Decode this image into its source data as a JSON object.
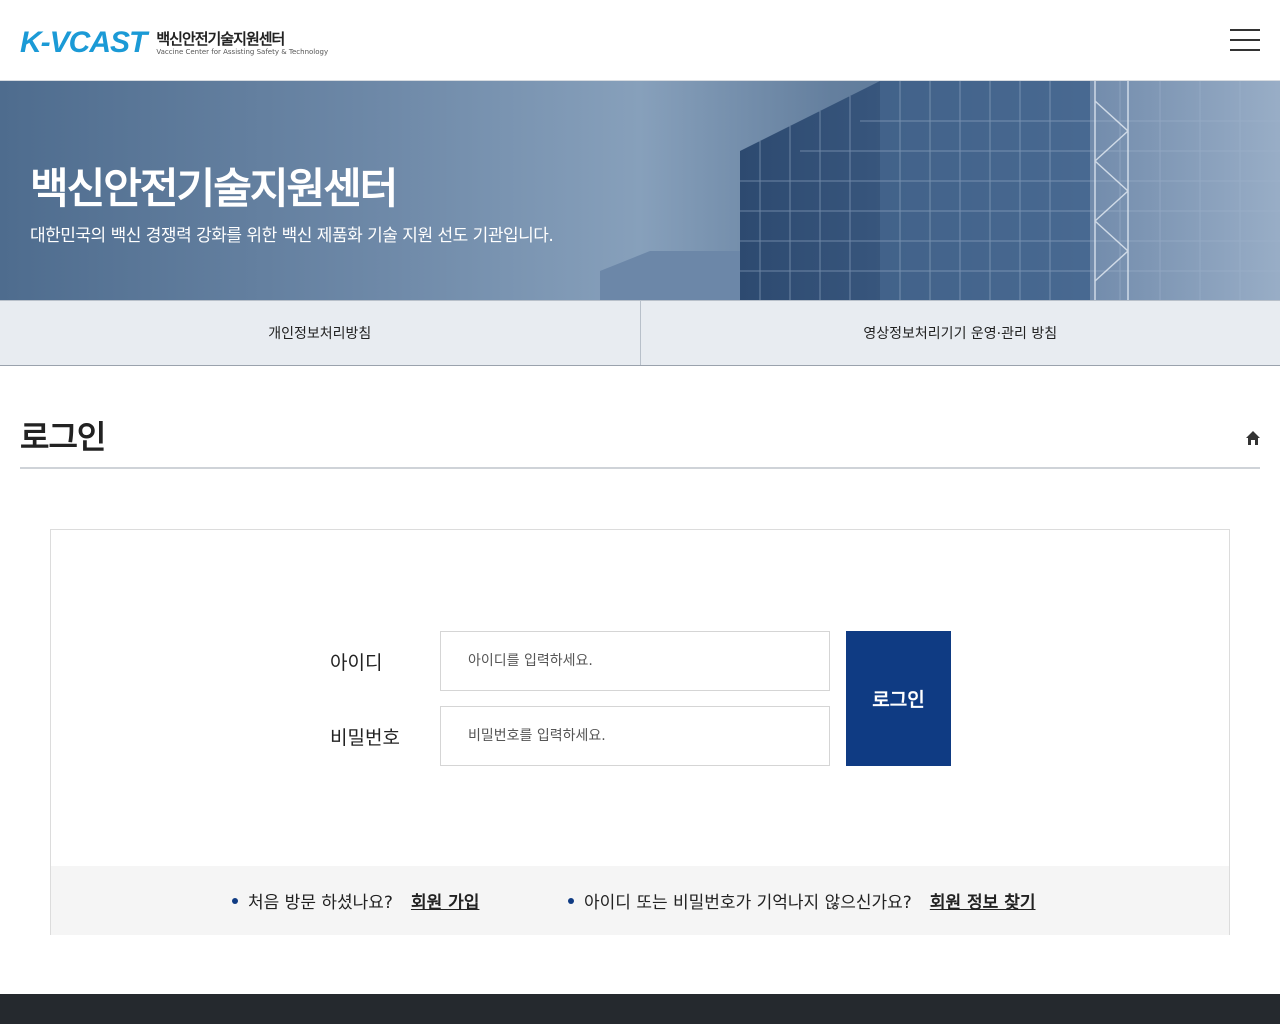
{
  "header": {
    "logo_mark": "K-VCAST",
    "logo_ko": "백신안전기술지원센터",
    "logo_en": "Vaccine Center for Assisting Safety & Technology",
    "menu_icon": "hamburger-menu-icon"
  },
  "hero": {
    "title": "백신안전기술지원센터",
    "subtitle": "대한민국의 백신 경쟁력 강화를 위한 백신 제품화 기술 지원 선도 기관입니다."
  },
  "subtabs": [
    {
      "label": "개인정보처리방침"
    },
    {
      "label": "영상정보처리기기 운영·관리 방침"
    }
  ],
  "page": {
    "title": "로그인",
    "home_icon": "home-icon"
  },
  "login": {
    "id_label": "아이디",
    "id_placeholder": "아이디를 입력하세요.",
    "pw_label": "비밀번호",
    "pw_placeholder": "비밀번호를 입력하세요.",
    "submit_label": "로그인",
    "accent_color": "#0f3b83"
  },
  "login_footer": {
    "first_visit_text": "처음 방문 하셨나요?",
    "signup_link": "회원 가입",
    "forgot_text": "아이디 또는 비밀번호가 기억나지 않으신가요?",
    "find_link": "회원 정보 찾기"
  }
}
